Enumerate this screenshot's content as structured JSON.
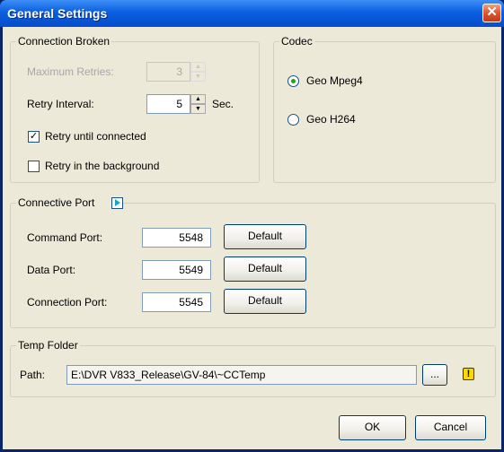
{
  "window": {
    "title": "General Settings"
  },
  "connection_broken": {
    "legend": "Connection Broken",
    "max_retries_label": "Maximum Retries:",
    "max_retries_value": "3",
    "retry_interval_label": "Retry Interval:",
    "retry_interval_value": "5",
    "retry_interval_unit": "Sec.",
    "retry_until_connected_label": "Retry until connected",
    "retry_until_connected_checked": true,
    "retry_background_label": "Retry in the background",
    "retry_background_checked": false
  },
  "codec": {
    "legend": "Codec",
    "options": [
      "Geo Mpeg4",
      "Geo H264"
    ],
    "selected": "Geo Mpeg4"
  },
  "connective_port": {
    "legend": "Connective Port",
    "default_label": "Default",
    "command_label": "Command Port:",
    "command_value": "5548",
    "data_label": "Data Port:",
    "data_value": "5549",
    "connection_label": "Connection Port:",
    "connection_value": "5545"
  },
  "temp_folder": {
    "legend": "Temp Folder",
    "path_label": "Path:",
    "path_value": "E:\\DVR V833_Release\\GV-84\\~CCTemp",
    "browse_label": "..."
  },
  "footer": {
    "ok_label": "OK",
    "cancel_label": "Cancel"
  },
  "colors": {
    "title_bar": "#0a5fe0",
    "dialog_bg": "#ece9d8",
    "close_button": "#e0532d"
  }
}
